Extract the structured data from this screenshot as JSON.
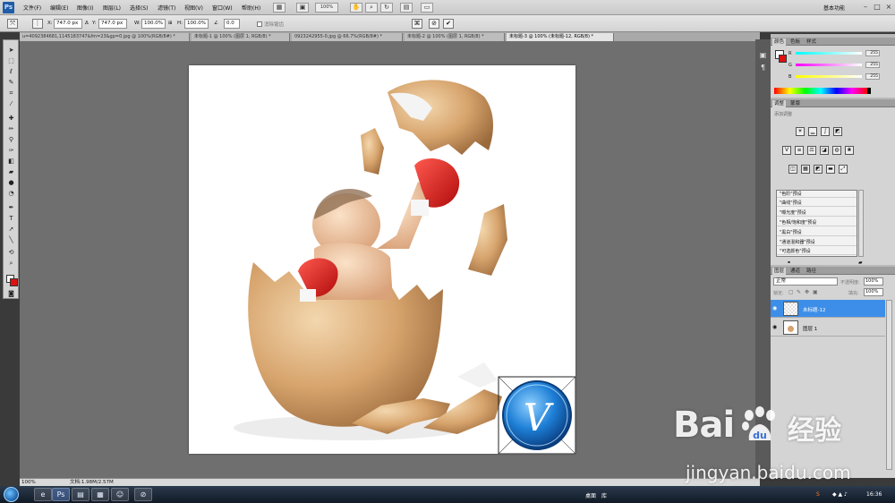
{
  "app": {
    "logo": "Ps",
    "menu": [
      "文件(F)",
      "编辑(E)",
      "图像(I)",
      "图层(L)",
      "选择(S)",
      "滤镜(T)",
      "视图(V)",
      "窗口(W)",
      "帮助(H)"
    ],
    "zoom_value": "100%",
    "workspace": "基本功能"
  },
  "options": {
    "x_label": "X:",
    "x_value": "747.0 px",
    "y_label": "Y:",
    "y_value": "747.0 px",
    "w_label": "W:",
    "w_value": "100.0%",
    "h_label": "H:",
    "h_value": "100.0%",
    "angle_value": "0.0",
    "antialias_label": "消除锯齿"
  },
  "tabs": [
    {
      "label": "u=4092384681,1145183747&fm=23&gp=0.jpg @ 100%(RGB/8#) *",
      "active": false
    },
    {
      "label": "未标题-1 @ 100% (图层 1, RGB/8) *",
      "active": false
    },
    {
      "label": "0923242955-0.jpg @ 66.7%(RGB/8#) *",
      "active": false
    },
    {
      "label": "未标题-2 @ 100% (图层 1, RGB/8) *",
      "active": false
    },
    {
      "label": "未标题-3 @ 100% (未标题-12, RGB/8) *",
      "active": true
    }
  ],
  "status": {
    "zoom": "100%",
    "doc_size": "文档:1.98M/2.57M"
  },
  "color_panel": {
    "tabs": [
      "颜色",
      "色板",
      "样式"
    ],
    "r_label": "R",
    "r_value": "255",
    "g_label": "G",
    "g_value": "255",
    "b_label": "B",
    "b_value": "255"
  },
  "adjust_panel": {
    "tabs": [
      "调整",
      "蒙版"
    ],
    "hint": "添加调整",
    "presets": [
      "\"色阶\"预设",
      "\"曲线\"预设",
      "\"曝光度\"预设",
      "\"色相/饱和度\"预设",
      "\"黑白\"预设",
      "\"通道混和器\"预设",
      "\"可选颜色\"预设"
    ]
  },
  "layers_panel": {
    "tabs": [
      "图层",
      "通道",
      "路径"
    ],
    "blend_mode": "正常",
    "opacity_label": "不透明度:",
    "opacity_value": "100%",
    "lock_label": "锁定:",
    "fill_label": "填充:",
    "fill_value": "100%",
    "layers": [
      {
        "name": "未标题-12",
        "selected": true
      },
      {
        "name": "图层 1",
        "selected": false
      }
    ]
  },
  "taskbar": {
    "desktop_label": "桌面",
    "library_label": "库",
    "clock": "16:36"
  },
  "watermark": {
    "brand": "Bai",
    "brand2": "经验",
    "brand_du": "du",
    "url": "jingyan.baidu.com"
  },
  "logo_badge": {
    "letter": "V"
  },
  "colors": {
    "accent_blue": "#3d8ee8",
    "foreground": "#ffffff",
    "background": "#dd1111"
  }
}
